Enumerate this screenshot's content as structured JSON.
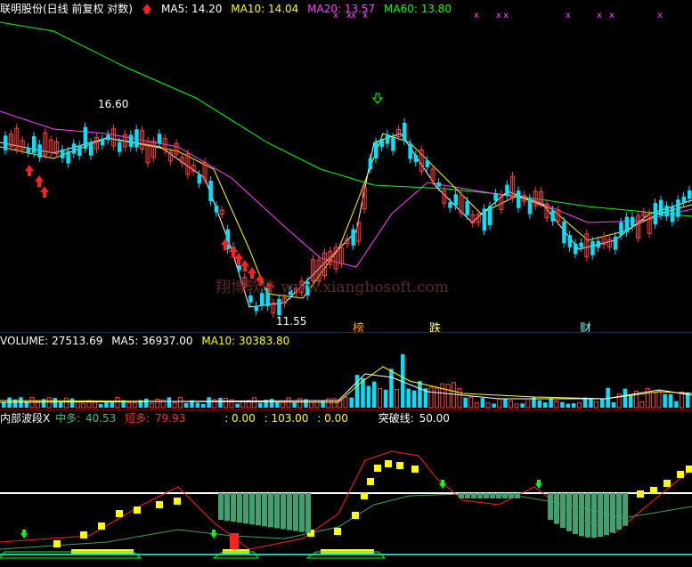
{
  "colors": {
    "up": "#ff4040",
    "down": "#00e0ff",
    "ma5": "#ffffff",
    "ma10": "#ffff00",
    "ma20": "#ff40ff",
    "ma60": "#00ff00",
    "yellow_bar": "#ffff00",
    "green_bar": "#40a070"
  },
  "header": {
    "stock_title": "联明股份(日线 前复权 对数)",
    "arrow_icon": "red-up-arrow-icon",
    "ma5": "MA5: 14.20",
    "ma10": "MA10: 14.04",
    "ma20": "MA20: 13.57",
    "ma60": "MA60: 13.80"
  },
  "price_chart": {
    "high_label": "16.60",
    "low_label": "11.55",
    "event_labels": [
      "榜",
      "跌",
      "财"
    ],
    "watermark": "翔博软件 www.xiangbosoft.com"
  },
  "volume_header": {
    "volume": "VOLUME: 27513.69",
    "ma5": "MA5: 36937.00",
    "ma10": "MA10: 30383.80"
  },
  "indicator_header": {
    "name": "内部波段X",
    "mid_label": "中多:",
    "mid_value": "40.53",
    "short_label": "短多:",
    "short_value": "79.93",
    "v1": ": 0.00",
    "v2": ": 103.00",
    "v3": ": 0.00",
    "break_label": "突破线:",
    "break_value": "50.00"
  }
}
